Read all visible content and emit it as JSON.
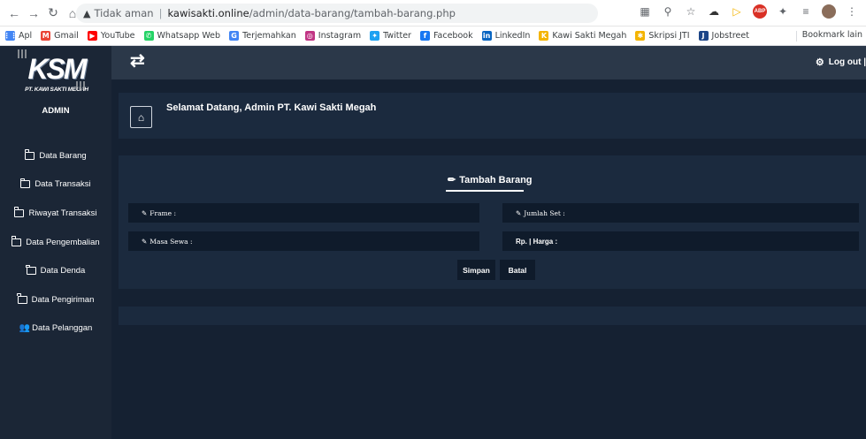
{
  "browser": {
    "warning": "Tidak aman",
    "url_domain": "kawisakti.online",
    "url_path": "/admin/data-barang/tambah-barang.php",
    "bookmarks": [
      {
        "label": "Apl",
        "icon": "apps-grid-icon",
        "color": "#4285f4"
      },
      {
        "label": "Gmail",
        "icon": "gmail-icon",
        "color": "#ea4335"
      },
      {
        "label": "YouTube",
        "icon": "youtube-icon",
        "color": "#ff0000"
      },
      {
        "label": "Whatsapp Web",
        "icon": "whatsapp-icon",
        "color": "#25d366"
      },
      {
        "label": "Terjemahkan",
        "icon": "translate-icon",
        "color": "#4285f4"
      },
      {
        "label": "Instagram",
        "icon": "instagram-icon",
        "color": "#c13584"
      },
      {
        "label": "Twitter",
        "icon": "twitter-icon",
        "color": "#1da1f2"
      },
      {
        "label": "Facebook",
        "icon": "facebook-icon",
        "color": "#1877f2"
      },
      {
        "label": "LinkedIn",
        "icon": "linkedin-icon",
        "color": "#0a66c2"
      },
      {
        "label": "Kawi Sakti Megah",
        "icon": "ksm-icon",
        "color": "#f4b400"
      },
      {
        "label": "Skripsi JTI",
        "icon": "star-icon",
        "color": "#f4b400"
      },
      {
        "label": "Jobstreet",
        "icon": "jobstreet-icon",
        "color": "#1c4587"
      }
    ],
    "bookmark_other": "Bookmark lain"
  },
  "sidebar": {
    "logo_text": "KSM",
    "logo_sub": "PT. KAWI SAKTI MEGAH",
    "admin_label": "ADMIN",
    "items": [
      {
        "label": "Data Barang",
        "icon": "folder-icon"
      },
      {
        "label": "Data Transaksi",
        "icon": "folder-icon"
      },
      {
        "label": "Riwayat Transaksi",
        "icon": "folder-icon"
      },
      {
        "label": "Data Pengembalian",
        "icon": "folder-icon"
      },
      {
        "label": "Data Denda",
        "icon": "folder-icon"
      },
      {
        "label": "Data Pengiriman",
        "icon": "folder-icon"
      },
      {
        "label": "Data Pelanggan",
        "icon": "users-icon"
      }
    ]
  },
  "topbar": {
    "logout_label": "Log out |"
  },
  "welcome": {
    "title": "Selamat Datang, Admin PT. Kawi Sakti Megah"
  },
  "form": {
    "title": "Tambah Barang",
    "fields": {
      "frame": "Frame :",
      "jumlah_set": "Jumlah Set :",
      "masa_sewa": "Masa Sewa :",
      "harga": "Rp. | Harga :"
    },
    "save_label": "Simpan",
    "cancel_label": "Batal"
  },
  "colors": {
    "sidebar_bg": "#1b2636",
    "topbar_bg": "#2b3849",
    "panel_bg": "#1b2a3e",
    "input_bg": "#0f1b2b"
  }
}
